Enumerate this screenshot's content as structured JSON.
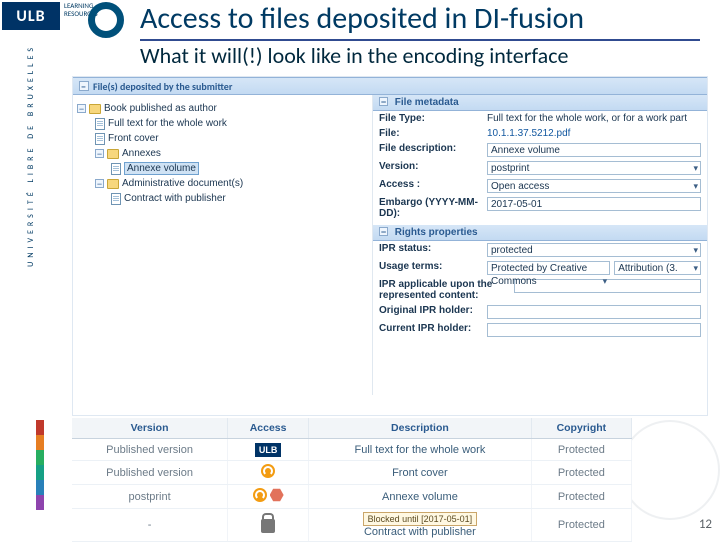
{
  "branding": {
    "ulb": "ULB",
    "vtext": "UNIVERSITÉ LIBRE DE BRUXELLES",
    "lr": "LEARNING RESOURCES"
  },
  "heading": "Access to files deposited in DI-fusion",
  "subheading": "What it will(!) look like in the encoding interface",
  "panel_title": "File(s) deposited by the submitter",
  "tree": {
    "root": "Book published as author",
    "c1": "Full text for the whole work",
    "c2": "Front cover",
    "c3": "Annexes",
    "c3a": "Annexe volume",
    "c4": "Administrative document(s)",
    "c4a": "Contract with publisher"
  },
  "meta": {
    "header": "File metadata",
    "filetype_lbl": "File Type:",
    "filetype_val": "Full text for the whole work, or for a work part",
    "file_lbl": "File:",
    "file_val": "10.1.1.37.5212.pdf",
    "desc_lbl": "File description:",
    "desc_val": "Annexe volume",
    "ver_lbl": "Version:",
    "ver_val": "postprint",
    "acc_lbl": "Access :",
    "acc_val": "Open access",
    "emb_lbl": "Embargo (YYYY-MM-DD):",
    "emb_val": "2017-05-01",
    "rights_header": "Rights properties",
    "ipr_lbl": "IPR status:",
    "ipr_val": "protected",
    "usage_lbl": "Usage terms:",
    "usage_val1": "Protected by Creative Commons",
    "usage_val2": "Attribution (3.",
    "iprapp_lbl": "IPR applicable upon the represented content:",
    "orig_lbl": "Original IPR holder:",
    "curr_lbl": "Current IPR holder:"
  },
  "table": {
    "headers": {
      "version": "Version",
      "access": "Access",
      "description": "Description",
      "copyright": "Copyright"
    },
    "rows": [
      {
        "version": "Published version",
        "icon": "ulb",
        "description": "Full text for the whole work",
        "copyright": "Protected",
        "note": ""
      },
      {
        "version": "Published version",
        "icon": "oa",
        "description": "Front cover",
        "copyright": "Protected",
        "note": ""
      },
      {
        "version": "postprint",
        "icon": "oa-hex",
        "description": "Annexe volume",
        "copyright": "Protected",
        "note": ""
      },
      {
        "version": "-",
        "icon": "lock",
        "description": "Contract with publisher",
        "copyright": "Protected",
        "note": "Blocked until [2017-05-01]"
      }
    ]
  },
  "pagenum": "12",
  "colors": [
    "#c0392b",
    "#e67e22",
    "#27ae60",
    "#16a085",
    "#2980b9",
    "#8e44ad"
  ]
}
